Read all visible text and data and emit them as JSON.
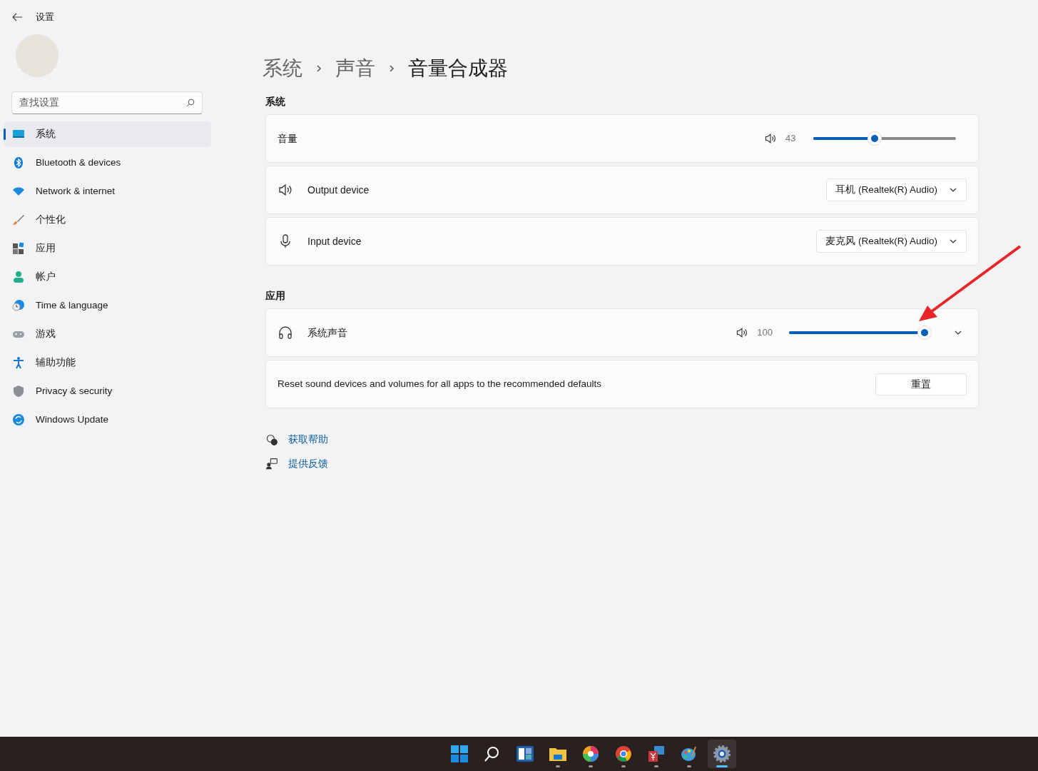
{
  "window": {
    "title": "设置"
  },
  "sidebar": {
    "search": {
      "placeholder": "查找设置"
    },
    "items": [
      {
        "label": "系统",
        "selected": true
      },
      {
        "label": "Bluetooth & devices",
        "selected": false
      },
      {
        "label": "Network & internet",
        "selected": false
      },
      {
        "label": "个性化",
        "selected": false
      },
      {
        "label": "应用",
        "selected": false
      },
      {
        "label": "帐户",
        "selected": false
      },
      {
        "label": "Time & language",
        "selected": false
      },
      {
        "label": "游戏",
        "selected": false
      },
      {
        "label": "辅助功能",
        "selected": false
      },
      {
        "label": "Privacy & security",
        "selected": false
      },
      {
        "label": "Windows Update",
        "selected": false
      }
    ]
  },
  "breadcrumb": [
    "系统",
    "声音",
    "音量合成器"
  ],
  "sections": [
    {
      "heading": "系统",
      "rows": [
        {
          "kind": "slider",
          "label": "音量",
          "reading": "43",
          "level": 0.43
        },
        {
          "kind": "dropdown",
          "label": "Output device",
          "value": "耳机 (Realtek(R) Audio)"
        },
        {
          "kind": "dropdown",
          "label": "Input device",
          "value": "麦克风 (Realtek(R) Audio)"
        }
      ]
    },
    {
      "heading": "应用",
      "rows": [
        {
          "kind": "app",
          "label": "系统声音",
          "reading": "100",
          "level": 1.0,
          "expanded": false
        },
        {
          "kind": "button",
          "label": "Reset sound devices and volumes for all apps to the recommended defaults",
          "button": "重置"
        }
      ]
    }
  ],
  "links": [
    "获取帮助",
    "提供反馈"
  ],
  "taskbar": [
    {
      "running": false,
      "selected": false
    },
    {
      "running": false,
      "selected": false
    },
    {
      "running": false,
      "selected": false
    },
    {
      "running": true,
      "selected": false
    },
    {
      "running": true,
      "selected": false
    },
    {
      "running": true,
      "selected": false
    },
    {
      "running": true,
      "selected": false
    },
    {
      "running": true,
      "selected": false
    },
    {
      "running": true,
      "selected": true
    }
  ]
}
